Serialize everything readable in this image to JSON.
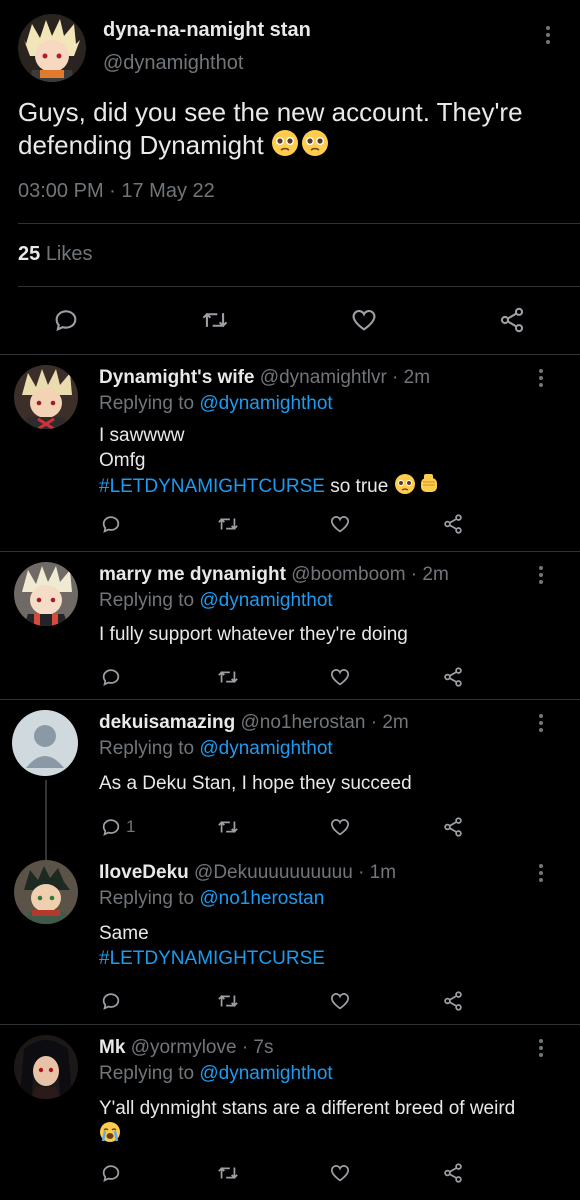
{
  "main_tweet": {
    "display_name": "dyna-na-namight stan",
    "handle": "@dynamighthot",
    "text": "Guys, did you see the new account. They're defending Dynamight",
    "text_emoji": "pleading-face x2",
    "timestamp": "03:00 PM · 17 May 22",
    "likes_count": "25",
    "likes_label": "Likes"
  },
  "replies": [
    {
      "name": "Dynamight's wife",
      "handle": "@dynamightlvr · 2m",
      "replying_label": "Replying to",
      "replying_to": "@dynamighthot",
      "line1": "I sawwww",
      "line2": "Omfg",
      "hashtag": "#LETDYNAMIGHTCURSE",
      "after_hashtag": " so true"
    },
    {
      "name": "marry me dynamight",
      "handle": "@boomboom · 2m",
      "replying_label": "Replying to",
      "replying_to": "@dynamighthot",
      "line1": "I fully support whatever they're doing"
    },
    {
      "name": "dekuisamazing",
      "handle": "@no1herostan · 2m",
      "replying_label": "Replying to",
      "replying_to": "@dynamighthot",
      "line1": "As a Deku Stan, I hope they succeed",
      "reply_count": "1"
    },
    {
      "name": "IloveDeku",
      "handle": "@Dekuuuuuuuuuu · 1m",
      "replying_label": "Replying to",
      "replying_to": "@no1herostan",
      "line1": "Same",
      "hashtag": "#LETDYNAMIGHTCURSE"
    },
    {
      "name": "Mk",
      "handle": "@yormylove · 7s",
      "replying_label": "Replying to",
      "replying_to": "@dynamighthot",
      "line1": "Y'all dynmight stans are a different breed of weird"
    }
  ],
  "icons": {
    "reply": "speech-bubble-icon",
    "retweet": "retweet-icon",
    "like": "heart-icon",
    "share": "share-icon",
    "more": "kebab-menu-icon"
  },
  "colors": {
    "background": "#000000",
    "text": "#e7e9ea",
    "muted": "#71767b",
    "link": "#1d9bf0",
    "divider": "#2f3336"
  }
}
